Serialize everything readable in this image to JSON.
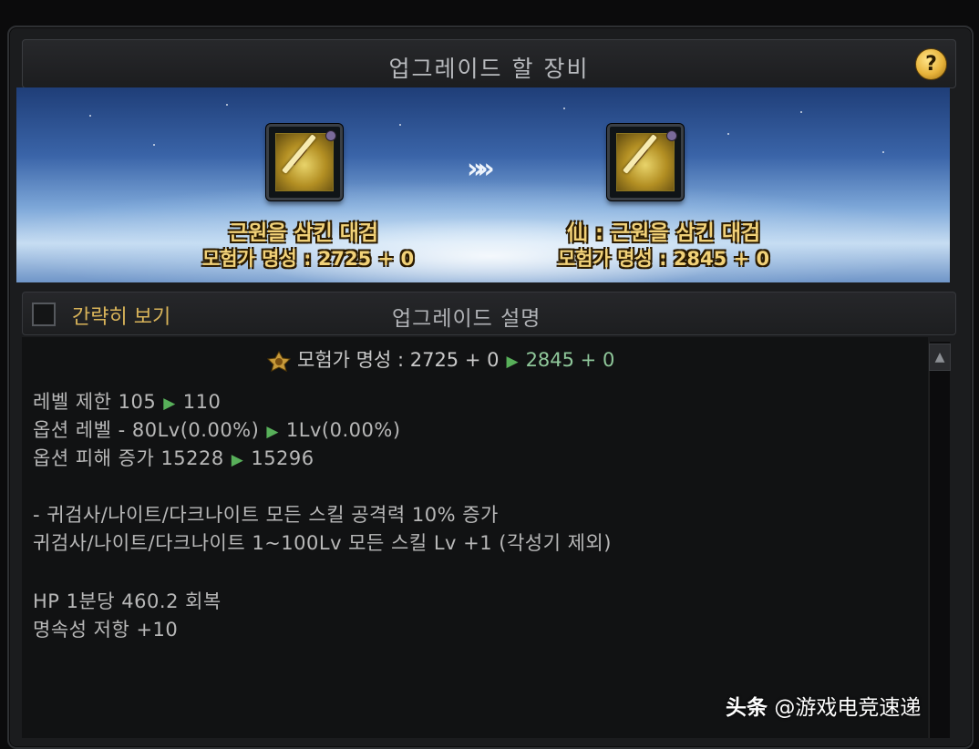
{
  "window": {
    "title": "업그레이드 할 장비",
    "help_label": "?"
  },
  "upgrade_preview": {
    "arrow_glyph": "»»",
    "from": {
      "name": "근원을 삼킨 대검",
      "fame": "모험가 명성 : 2725 + 0",
      "icon": "greatsword-icon"
    },
    "to": {
      "name": "仙 : 근원을 삼킨 대검",
      "fame": "모험가 명성 : 2845 + 0",
      "icon": "greatsword-icon"
    }
  },
  "toolbar": {
    "simple_view_label": "간략히 보기",
    "simple_view_checked": false,
    "section_title": "업그레이드 설명"
  },
  "description": {
    "fame": {
      "label": "모험가 명성 :",
      "from": "2725 + 0",
      "to": "2845 + 0"
    },
    "stats": [
      {
        "label": "레벨 제한 105",
        "to": "110"
      },
      {
        "label": "옵션 레벨 - 80Lv(0.00%)",
        "to": "1Lv(0.00%)"
      },
      {
        "label": "옵션 피해 증가 15228",
        "to": "15296"
      }
    ],
    "options": [
      "- 귀검사/나이트/다크나이트 모든 스킬 공격력 10% 증가",
      "귀검사/나이트/다크나이트 1~100Lv 모든 스킬 Lv +1 (각성기 제외)"
    ],
    "extras": [
      "HP 1분당 460.2 회복",
      "명속성 저항 +10"
    ],
    "arrow_glyph": "▶",
    "scroll_up_glyph": "▲"
  },
  "watermark": {
    "brand": "头条",
    "handle": "@游戏电竞速递"
  },
  "colors": {
    "accent_gold": "#f1d178",
    "increase_green": "#58b05a",
    "panel_bg": "#111213"
  }
}
